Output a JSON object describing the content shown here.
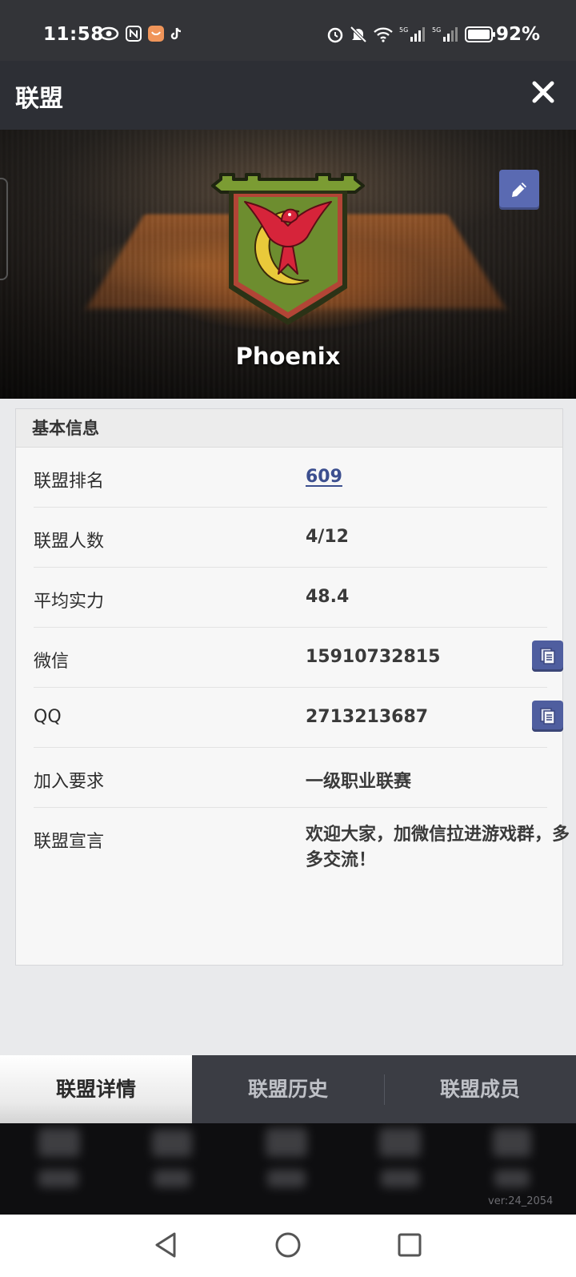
{
  "status_bar": {
    "time": "11:58",
    "battery_percent": "92%",
    "network_labels": [
      "5G",
      "5G"
    ]
  },
  "header": {
    "title": "联盟"
  },
  "alliance": {
    "name": "Phoenix",
    "crest_colors": {
      "banner_green": "#6d8d2f",
      "border_dark": "#2a2f14",
      "phoenix_red": "#d6243a",
      "moon_yellow": "#e9c93a"
    }
  },
  "basic_info": {
    "section_title": "基本信息",
    "rows": [
      {
        "label": "联盟排名",
        "value": "609"
      },
      {
        "label": "联盟人数",
        "value": "4/12"
      },
      {
        "label": "平均实力",
        "value": "48.4"
      },
      {
        "label": "微信",
        "value": "15910732815"
      },
      {
        "label": "QQ",
        "value": "2713213687"
      },
      {
        "label": "加入要求",
        "value": "一级职业联赛"
      },
      {
        "label": "联盟宣言",
        "value": "欢迎大家，加微信拉进游戏群，多多交流！"
      }
    ]
  },
  "tabs": [
    {
      "label": "联盟详情",
      "active": true
    },
    {
      "label": "联盟历史",
      "active": false
    },
    {
      "label": "联盟成员",
      "active": false
    }
  ],
  "footer": {
    "version": "ver:24_2054"
  },
  "colors": {
    "accent_button": "#5a6ab2",
    "link": "#3c4f8f",
    "header_bg": "#2d2f35"
  }
}
